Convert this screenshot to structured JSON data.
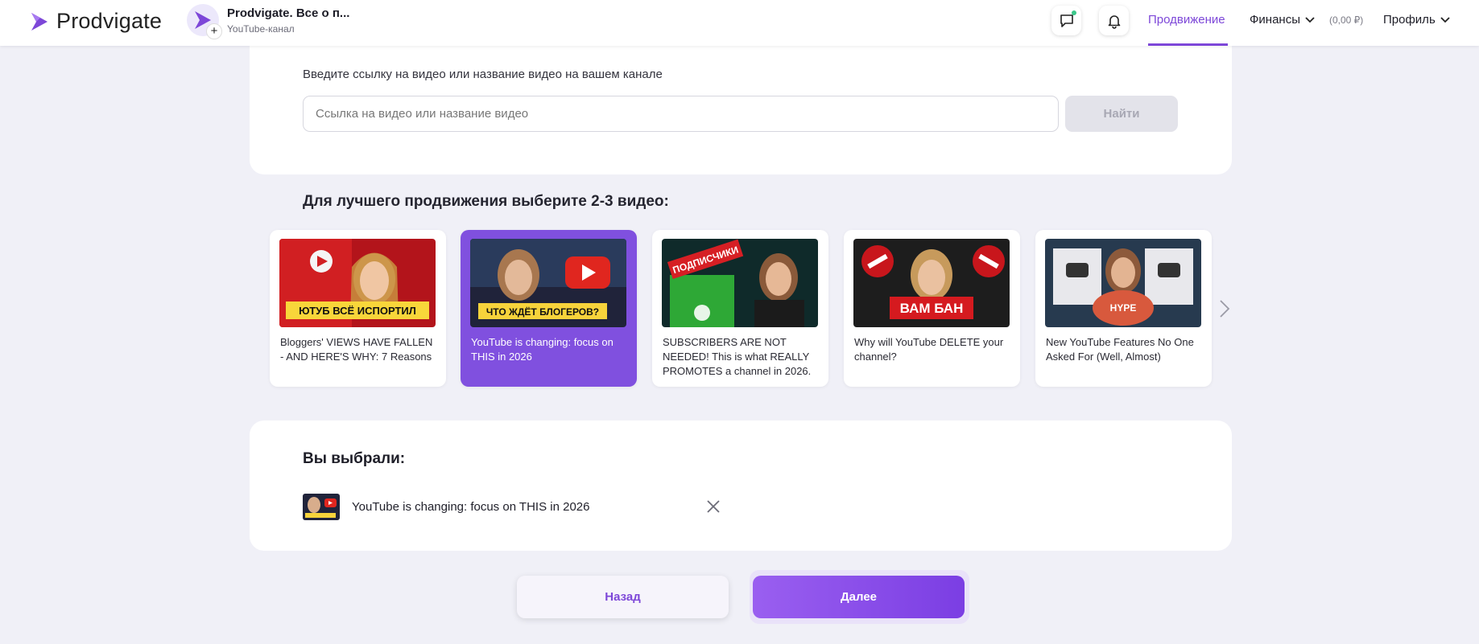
{
  "header": {
    "logo_text": "Prodvigate",
    "channel_name": "Prodvigate. Все о п...",
    "channel_type": "YouTube-канал",
    "nav": {
      "promotion": "Продвижение",
      "finance": "Финансы",
      "balance": "(0,00 ₽)",
      "profile": "Профиль"
    },
    "accent_color": "#7d47d8"
  },
  "search": {
    "hint": "Введите ссылку на видео или название видео на вашем канале",
    "placeholder": "Ссылка на видео или название видео",
    "value": "",
    "button_label": "Найти"
  },
  "videos_section": {
    "title": "Для лучшего продвижения выберите 2-3 видео:",
    "items": [
      {
        "title": "Bloggers' VIEWS HAVE FALLEN - AND HERE'S WHY: 7 Reasons",
        "thumb_text": "ЮТУБ ВСЁ ИСПОРТИЛ",
        "selected": false
      },
      {
        "title": "YouTube is changing: focus on THIS in 2026",
        "thumb_text": "ЧТО ЖДЁТ БЛОГЕРОВ?",
        "selected": true
      },
      {
        "title": "SUBSCRIBERS ARE NOT NEEDED! This is what REALLY PROMOTES a channel in 2026.",
        "thumb_text": "ПОДПИСЧИКИ",
        "selected": false
      },
      {
        "title": "Why will YouTube DELETE your channel?",
        "thumb_text": "ВАМ БАН",
        "selected": false
      },
      {
        "title": "New YouTube Features No One Asked For (Well, Almost)",
        "thumb_text": "HYPE",
        "selected": false
      }
    ]
  },
  "selected_section": {
    "title": "Вы выбрали:",
    "items": [
      {
        "title": "YouTube is changing: focus on THIS in 2026"
      }
    ]
  },
  "footer": {
    "back_label": "Назад",
    "next_label": "Далее"
  }
}
